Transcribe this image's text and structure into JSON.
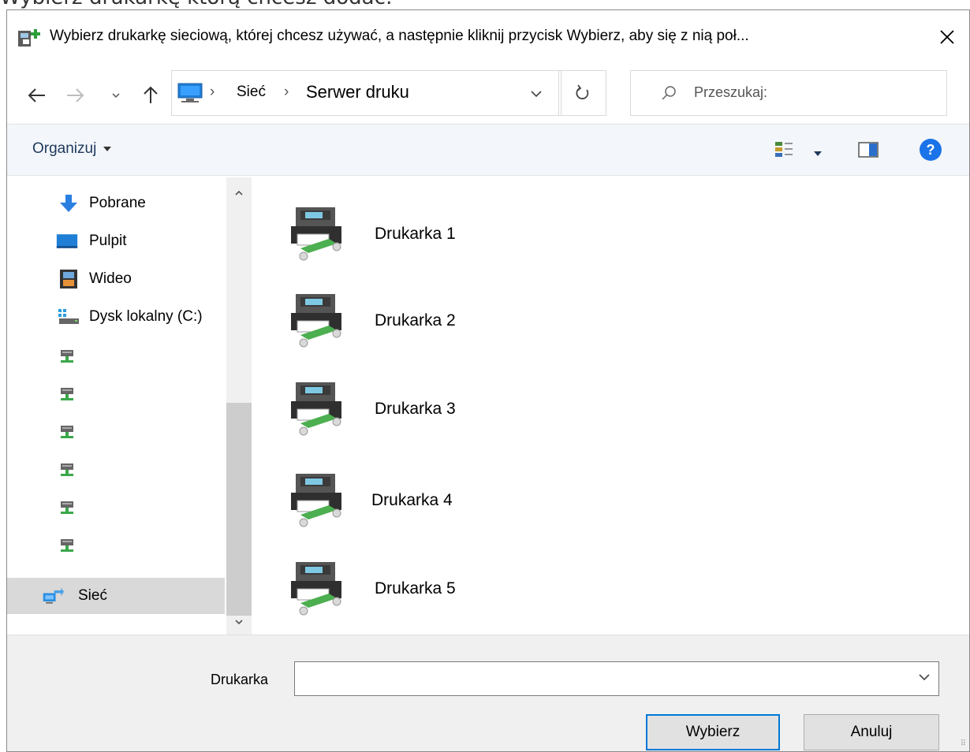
{
  "background_text": "Wybierz drukarkę którą chcesz dodać:",
  "dialog": {
    "title": "Wybierz drukarkę sieciową, której chcesz używać, a następnie kliknij przycisk Wybierz, aby się z nią poł...",
    "close_icon": "close-icon"
  },
  "navigation": {
    "back_icon": "back-arrow-icon",
    "forward_icon": "forward-arrow-icon",
    "recent_icon": "chevron-down-icon",
    "up_icon": "up-arrow-icon",
    "breadcrumb": [
      "Sieć",
      "Serwer druku"
    ],
    "search_placeholder": "Przeszukaj:"
  },
  "toolbar": {
    "organize_label": "Organizuj"
  },
  "sidebar": {
    "items": [
      {
        "label": "Pobrane",
        "icon": "download-icon"
      },
      {
        "label": "Pulpit",
        "icon": "desktop-icon"
      },
      {
        "label": "Wideo",
        "icon": "video-icon"
      },
      {
        "label": "Dysk lokalny (C:)",
        "icon": "drive-icon"
      },
      {
        "label": "",
        "icon": "network-drive-icon"
      },
      {
        "label": "",
        "icon": "network-drive-icon"
      },
      {
        "label": "",
        "icon": "network-drive-icon"
      },
      {
        "label": "",
        "icon": "network-drive-icon"
      },
      {
        "label": "",
        "icon": "network-drive-icon"
      },
      {
        "label": "",
        "icon": "network-drive-icon"
      },
      {
        "label": "Sieć",
        "icon": "network-icon",
        "selected": true
      }
    ]
  },
  "printers": [
    {
      "label": "Drukarka 1"
    },
    {
      "label": "Drukarka 2"
    },
    {
      "label": "Drukarka 3"
    },
    {
      "label": "Drukarka 4"
    },
    {
      "label": "Drukarka 5"
    }
  ],
  "footer": {
    "field_label": "Drukarka",
    "field_value": "",
    "select_button": "Wybierz",
    "cancel_button": "Anuluj"
  },
  "colors": {
    "accent": "#0078d7",
    "toolbar_bg": "#f3f6fa",
    "footer_bg": "#f0f0f0",
    "selected_bg": "#d9d9d9",
    "printer_green": "#4caf50",
    "help_blue": "#1a73e8"
  }
}
